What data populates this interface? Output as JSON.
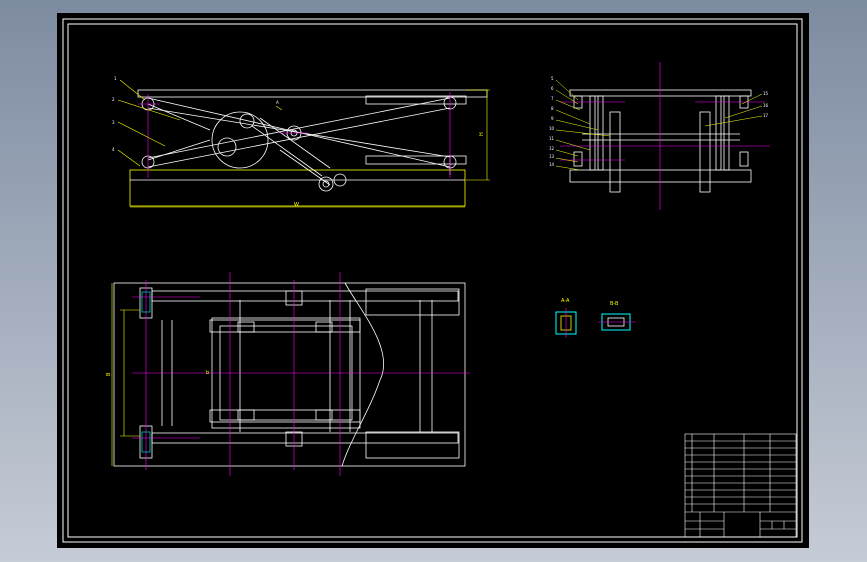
{
  "colors": {
    "background": "#000000",
    "frame": "#ffffff",
    "outline": "#ffffff",
    "dimension": "#ffff00",
    "centerline": "#ff00ff",
    "hidden": "#00ffff",
    "section": "#00ffff"
  },
  "front_view": {
    "part_callouts": [
      "1",
      "2",
      "3",
      "4"
    ],
    "dims": {
      "height": "H",
      "width": "W",
      "center": "A"
    }
  },
  "side_view": {
    "left_callouts": [
      "5",
      "6",
      "7",
      "8",
      "9",
      "10",
      "11",
      "12",
      "13",
      "14"
    ],
    "right_callouts": [
      "15",
      "16",
      "17"
    ]
  },
  "plan_view": {
    "dims": {
      "overall_width": "B",
      "inner_width": "b"
    }
  },
  "details": {
    "detail_a_title": "A-A",
    "detail_b_title": "B-B"
  },
  "title_block": {
    "rows": 12,
    "cols": 5
  }
}
